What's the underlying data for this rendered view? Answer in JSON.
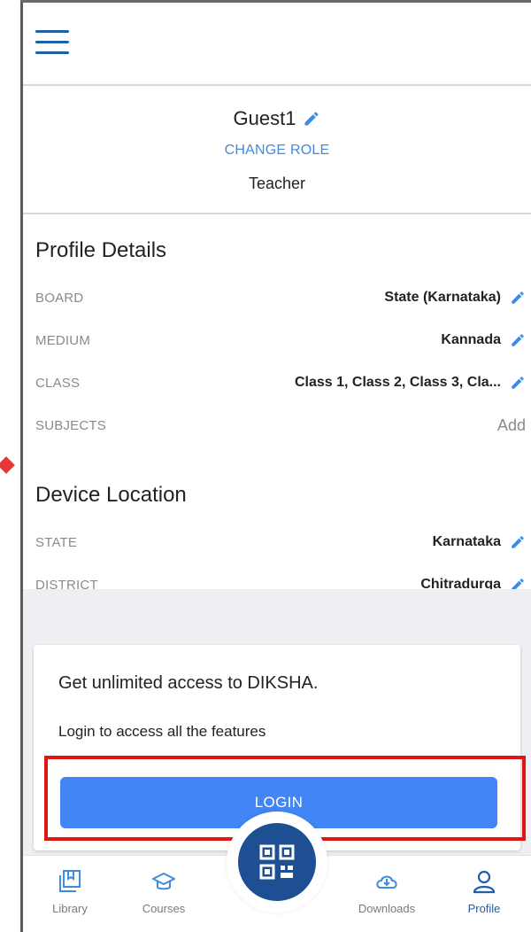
{
  "profile": {
    "name": "Guest1",
    "change_role_label": "CHANGE ROLE",
    "role": "Teacher"
  },
  "profile_details": {
    "title": "Profile Details",
    "rows": [
      {
        "label": "BOARD",
        "value": "State (Karnataka)"
      },
      {
        "label": "MEDIUM",
        "value": "Kannada"
      },
      {
        "label": "CLASS",
        "value": "Class 1, Class 2, Class 3, Cla..."
      },
      {
        "label": "SUBJECTS",
        "value": "Add"
      }
    ]
  },
  "device_location": {
    "title": "Device Location",
    "rows": [
      {
        "label": "STATE",
        "value": "Karnataka"
      },
      {
        "label": "DISTRICT",
        "value": "Chitradurga"
      }
    ]
  },
  "login_card": {
    "title": "Get unlimited access to DIKSHA.",
    "subtitle": "Login to access all the features",
    "button_label": "LOGIN"
  },
  "bottom_nav": {
    "items": [
      {
        "label": "Library",
        "icon": "library-icon"
      },
      {
        "label": "Courses",
        "icon": "courses-icon"
      },
      {
        "label": "Downloads",
        "icon": "downloads-icon"
      },
      {
        "label": "Profile",
        "icon": "profile-icon",
        "active": true
      }
    ],
    "center_icon": "qr-scan-icon"
  },
  "colors": {
    "primary": "#1d4f92",
    "accent": "#4285f4",
    "link": "#3f8be0",
    "highlight": "#e01414"
  }
}
